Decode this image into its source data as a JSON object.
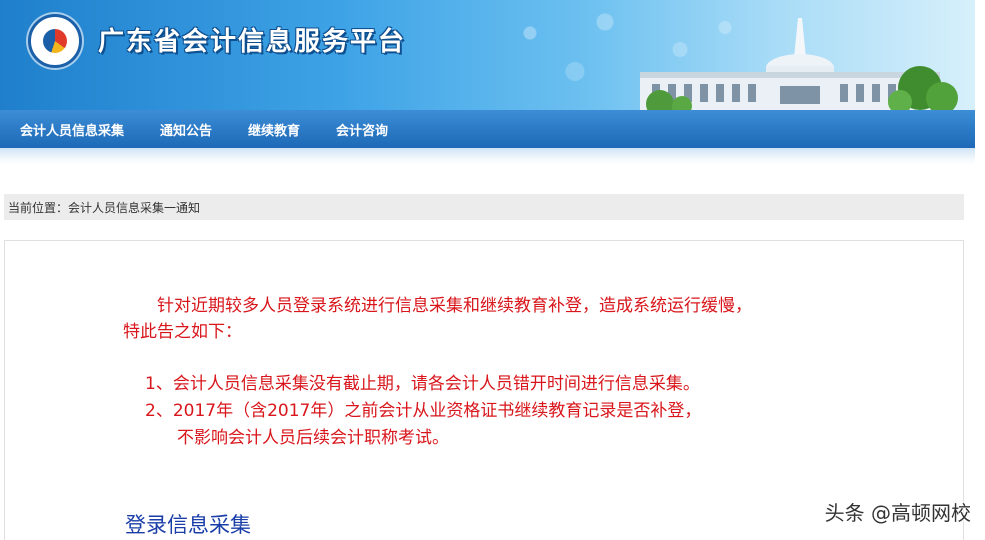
{
  "header": {
    "site_title": "广东省会计信息服务平台"
  },
  "nav": {
    "items": [
      {
        "label": "会计人员信息采集"
      },
      {
        "label": "通知公告"
      },
      {
        "label": "继续教育"
      },
      {
        "label": "会计咨询"
      }
    ]
  },
  "breadcrumb": {
    "prefix": "当前位置：",
    "path": "会计人员信息采集一通知"
  },
  "notice": {
    "intro_line1": "针对近期较多人员登录系统进行信息采集和继续教育补登，造成系统运行缓慢，",
    "intro_line2": "特此告之如下：",
    "item1": "1、会计人员信息采集没有截止期，请各会计人员错开时间进行信息采集。",
    "item2_line1": "2、2017年（含2017年）之前会计从业资格证书继续教育记录是否补登，",
    "item2_line2": "不影响会计人员后续会计职称考试。",
    "login_link": "登录信息采集"
  },
  "watermark": "头条 @高顿网校",
  "colors": {
    "notice_text": "#d8161b",
    "link": "#1a3da8",
    "nav_bg": "#1d69b7"
  }
}
